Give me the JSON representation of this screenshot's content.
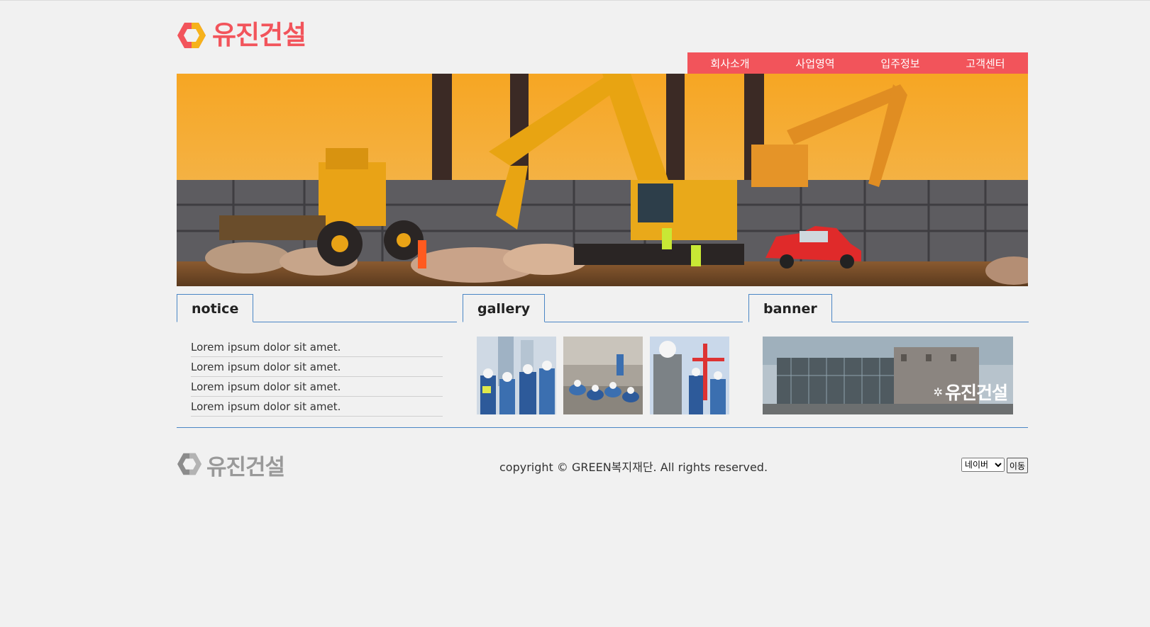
{
  "header": {
    "logo_text": "유진건설",
    "brand_color": "#f2545b",
    "nav": [
      {
        "label": "회사소개"
      },
      {
        "label": "사업영역"
      },
      {
        "label": "입주정보"
      },
      {
        "label": "고객센터"
      }
    ]
  },
  "sections": {
    "notice": {
      "title": "notice",
      "items": [
        "Lorem ipsum dolor sit amet.",
        "Lorem ipsum dolor sit amet.",
        "Lorem ipsum dolor sit amet.",
        "Lorem ipsum dolor sit amet."
      ]
    },
    "gallery": {
      "title": "gallery"
    },
    "banner": {
      "title": "banner",
      "logo_text": "유진건설"
    }
  },
  "footer": {
    "logo_text": "유진건설",
    "copyright": "copyright © GREEN복지재단. All rights reserved.",
    "family_select_value": "네이버",
    "go_button": "이동"
  }
}
